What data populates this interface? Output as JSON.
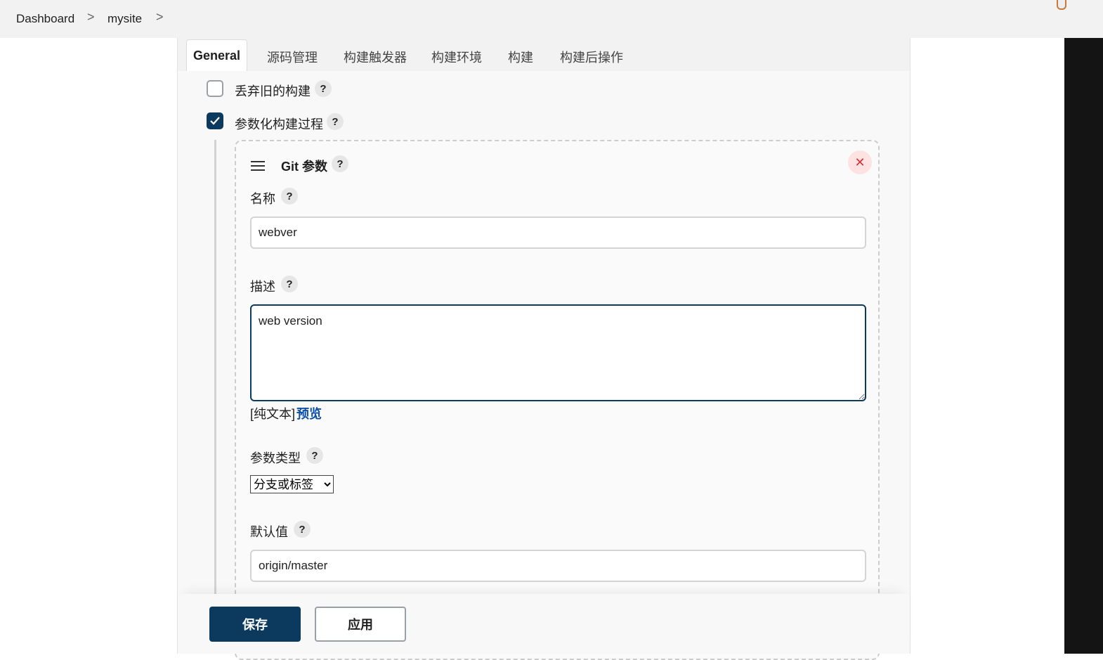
{
  "breadcrumb": {
    "items": [
      "Dashboard",
      "mysite"
    ],
    "separator": ">"
  },
  "tabs": [
    "General",
    "源码管理",
    "构建触发器",
    "构建环境",
    "构建",
    "构建后操作"
  ],
  "options": {
    "discard_old_builds": {
      "label": "丢弃旧的构建",
      "checked": false
    },
    "parameterized": {
      "label": "参数化构建过程",
      "checked": true
    }
  },
  "help_glyph": "?",
  "git_param": {
    "title": "Git 参数",
    "close_glyph": "✕",
    "name_label": "名称",
    "name_value": "webver",
    "desc_label": "描述",
    "desc_value": "web version",
    "plain_text": "[纯文本]",
    "preview_link": "预览",
    "type_label": "参数类型",
    "type_value": "分支或标签",
    "default_label": "默认值",
    "default_value": "origin/master"
  },
  "buttons": {
    "save": "保存",
    "apply": "应用"
  },
  "colors": {
    "primary": "#0b3a5e",
    "close_bg": "#fde2e2",
    "close_fg": "#d6303a",
    "link": "#0b4fa8"
  }
}
